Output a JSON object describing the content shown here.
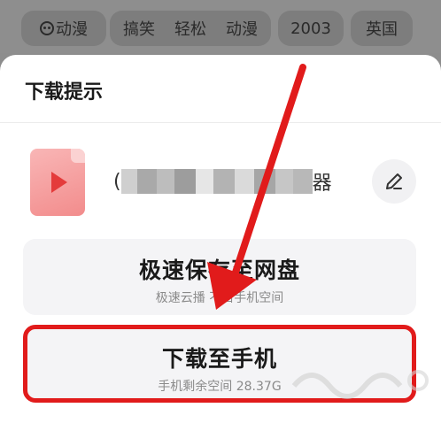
{
  "tags": {
    "category": {
      "label": "动漫",
      "icon": "face-icon"
    },
    "genres": [
      "搞笑",
      "轻松",
      "动漫"
    ],
    "year": "2003",
    "region": "英国"
  },
  "sheet": {
    "title": "下载提示",
    "file": {
      "name_start": "(",
      "name_end": "器",
      "icon": "video-file-icon"
    },
    "edit_icon": "pencil-icon",
    "options": [
      {
        "title": "极速保存至网盘",
        "subtitle": "极速云播 不占手机空间"
      },
      {
        "title": "下载至手机",
        "subtitle": "手机剩余空间 28.37G"
      }
    ]
  },
  "colors": {
    "annotation": "#e11b1b",
    "accent": "#e43b3b"
  }
}
